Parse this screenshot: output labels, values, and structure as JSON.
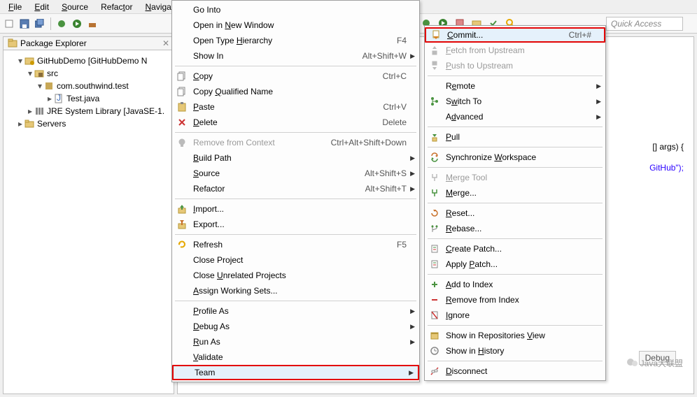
{
  "menubar": {
    "items": [
      "File",
      "Edit",
      "Source",
      "Refactor",
      "Navigate"
    ]
  },
  "quick_access": "Quick Access",
  "explorer": {
    "title": "Package Explorer",
    "tree": {
      "project": "GitHubDemo  [GitHubDemo N",
      "src": "src",
      "pkg": "com.southwind.test",
      "file": "Test.java",
      "jre": "JRE System Library [JavaSE-1.",
      "servers": "Servers"
    }
  },
  "editor": {
    "line1_a": "[] args) {",
    "line2_a": "GitHub\");",
    "debug_tab": "Debug"
  },
  "ctx1": [
    {
      "label": "Go Into"
    },
    {
      "label": "Open in New Window",
      "hasUnderline": "N"
    },
    {
      "label": "Open Type Hierarchy",
      "hasUnderline": "H",
      "accel": "F4"
    },
    {
      "label": "Show In",
      "hasUnderline": "W",
      "accel": "Alt+Shift+W",
      "submenu": true
    },
    {
      "sep": true
    },
    {
      "label": "Copy",
      "hasUnderline": "C",
      "accel": "Ctrl+C",
      "icon": "copy"
    },
    {
      "label": "Copy Qualified Name",
      "hasUnderline": "Q",
      "icon": "copy"
    },
    {
      "label": "Paste",
      "hasUnderline": "P",
      "accel": "Ctrl+V",
      "icon": "paste"
    },
    {
      "label": "Delete",
      "hasUnderline": "D",
      "accel": "Delete",
      "icon": "delete"
    },
    {
      "sep": true
    },
    {
      "label": "Remove from Context",
      "accel": "Ctrl+Alt+Shift+Down",
      "disabled": true,
      "icon": "bulb"
    },
    {
      "label": "Build Path",
      "hasUnderline": "B",
      "submenu": true
    },
    {
      "label": "Source",
      "hasUnderline": "S",
      "accel": "Alt+Shift+S",
      "submenu": true
    },
    {
      "label": "Refactor",
      "hasUnderline": "T",
      "accel": "Alt+Shift+T",
      "submenu": true
    },
    {
      "sep": true
    },
    {
      "label": "Import...",
      "hasUnderline": "I",
      "icon": "import"
    },
    {
      "label": "Export...",
      "hasUnderline": "O",
      "icon": "export"
    },
    {
      "sep": true
    },
    {
      "label": "Refresh",
      "hasUnderline": "F",
      "accel": "F5",
      "icon": "refresh"
    },
    {
      "label": "Close Project",
      "hasUnderline": "S"
    },
    {
      "label": "Close Unrelated Projects",
      "hasUnderline": "U"
    },
    {
      "label": "Assign Working Sets...",
      "hasUnderline": "A"
    },
    {
      "sep": true
    },
    {
      "label": "Profile As",
      "hasUnderline": "P",
      "submenu": true
    },
    {
      "label": "Debug As",
      "hasUnderline": "D",
      "submenu": true
    },
    {
      "label": "Run As",
      "hasUnderline": "R",
      "submenu": true
    },
    {
      "label": "Validate",
      "hasUnderline": "V"
    },
    {
      "label": "Team",
      "hasUnderline": "E",
      "submenu": true,
      "highlight": true,
      "hover": true
    }
  ],
  "ctx2": [
    {
      "label": "Commit...",
      "hasUnderline": "C",
      "accel": "Ctrl+#",
      "icon": "commit",
      "highlight": true,
      "hover": true
    },
    {
      "label": "Fetch from Upstream",
      "hasUnderline": "F",
      "disabled": true,
      "icon": "fetch"
    },
    {
      "label": "Push to Upstream",
      "hasUnderline": "P",
      "disabled": true,
      "icon": "push"
    },
    {
      "sep": true
    },
    {
      "label": "Remote",
      "hasUnderline": "e",
      "submenu": true
    },
    {
      "label": "Switch To",
      "hasUnderline": "w",
      "submenu": true,
      "icon": "branch"
    },
    {
      "label": "Advanced",
      "hasUnderline": "d",
      "submenu": true
    },
    {
      "sep": true
    },
    {
      "label": "Pull",
      "hasUnderline": "P",
      "icon": "pull"
    },
    {
      "sep": true
    },
    {
      "label": "Synchronize Workspace",
      "hasUnderline": "W",
      "icon": "sync"
    },
    {
      "sep": true
    },
    {
      "label": "Merge Tool",
      "hasUnderline": "M",
      "disabled": true,
      "icon": "mergetool"
    },
    {
      "label": "Merge...",
      "hasUnderline": "M",
      "icon": "merge"
    },
    {
      "sep": true
    },
    {
      "label": "Reset...",
      "hasUnderline": "R",
      "icon": "reset"
    },
    {
      "label": "Rebase...",
      "hasUnderline": "R",
      "icon": "rebase"
    },
    {
      "sep": true
    },
    {
      "label": "Create Patch...",
      "hasUnderline": "C",
      "icon": "patch"
    },
    {
      "label": "Apply Patch...",
      "hasUnderline": "P",
      "icon": "patch"
    },
    {
      "sep": true
    },
    {
      "label": "Add to Index",
      "hasUnderline": "A",
      "icon": "add"
    },
    {
      "label": "Remove from Index",
      "hasUnderline": "R",
      "icon": "remove"
    },
    {
      "label": "Ignore",
      "hasUnderline": "I",
      "icon": "ignore"
    },
    {
      "sep": true
    },
    {
      "label": "Show in Repositories View",
      "hasUnderline": "V",
      "icon": "repo"
    },
    {
      "label": "Show in History",
      "hasUnderline": "H",
      "icon": "history"
    },
    {
      "sep": true
    },
    {
      "label": "Disconnect",
      "hasUnderline": "D",
      "icon": "disconnect"
    }
  ],
  "watermark": "Java大联盟"
}
